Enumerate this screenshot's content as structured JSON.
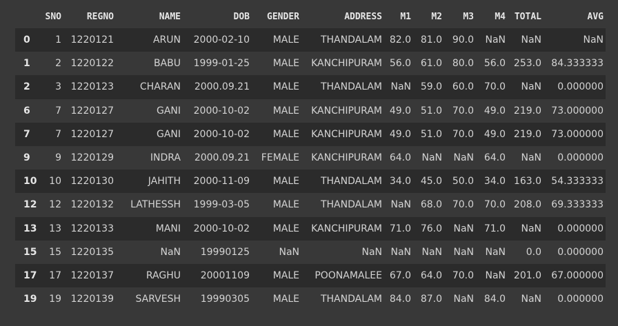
{
  "columns": [
    "",
    "SNO",
    "REGNO",
    "NAME",
    "DOB",
    "GENDER",
    "ADDRESS",
    "M1",
    "M2",
    "M3",
    "M4",
    "TOTAL",
    "AVG"
  ],
  "rows": [
    [
      "0",
      "1",
      "1220121",
      "ARUN",
      "2000-02-10",
      "MALE",
      "THANDALAM",
      "82.0",
      "81.0",
      "90.0",
      "NaN",
      "NaN",
      "NaN"
    ],
    [
      "1",
      "2",
      "1220122",
      "BABU",
      "1999-01-25",
      "MALE",
      "KANCHIPURAM",
      "56.0",
      "61.0",
      "80.0",
      "56.0",
      "253.0",
      "84.333333"
    ],
    [
      "2",
      "3",
      "1220123",
      "CHARAN",
      "2000.09.21",
      "MALE",
      "THANDALAM",
      "NaN",
      "59.0",
      "60.0",
      "70.0",
      "NaN",
      "0.000000"
    ],
    [
      "6",
      "7",
      "1220127",
      "GANI",
      "2000-10-02",
      "MALE",
      "KANCHIPURAM",
      "49.0",
      "51.0",
      "70.0",
      "49.0",
      "219.0",
      "73.000000"
    ],
    [
      "7",
      "7",
      "1220127",
      "GANI",
      "2000-10-02",
      "MALE",
      "KANCHIPURAM",
      "49.0",
      "51.0",
      "70.0",
      "49.0",
      "219.0",
      "73.000000"
    ],
    [
      "9",
      "9",
      "1220129",
      "INDRA",
      "2000.09.21",
      "FEMALE",
      "KANCHIPURAM",
      "64.0",
      "NaN",
      "NaN",
      "64.0",
      "NaN",
      "0.000000"
    ],
    [
      "10",
      "10",
      "1220130",
      "JAHITH",
      "2000-11-09",
      "MALE",
      "THANDALAM",
      "34.0",
      "45.0",
      "50.0",
      "34.0",
      "163.0",
      "54.333333"
    ],
    [
      "12",
      "12",
      "1220132",
      "LATHESSH",
      "1999-03-05",
      "MALE",
      "THANDALAM",
      "NaN",
      "68.0",
      "70.0",
      "70.0",
      "208.0",
      "69.333333"
    ],
    [
      "13",
      "13",
      "1220133",
      "MANI",
      "2000-10-02",
      "MALE",
      "KANCHIPURAM",
      "71.0",
      "76.0",
      "NaN",
      "71.0",
      "NaN",
      "0.000000"
    ],
    [
      "15",
      "15",
      "1220135",
      "NaN",
      "19990125",
      "NaN",
      "NaN",
      "NaN",
      "NaN",
      "NaN",
      "NaN",
      "0.0",
      "0.000000"
    ],
    [
      "17",
      "17",
      "1220137",
      "RAGHU",
      "20001109",
      "MALE",
      "POONAMALEE",
      "67.0",
      "64.0",
      "70.0",
      "NaN",
      "201.0",
      "67.000000"
    ],
    [
      "19",
      "19",
      "1220139",
      "SARVESH",
      "19990305",
      "MALE",
      "THANDALAM",
      "84.0",
      "87.0",
      "NaN",
      "84.0",
      "NaN",
      "0.000000"
    ]
  ]
}
